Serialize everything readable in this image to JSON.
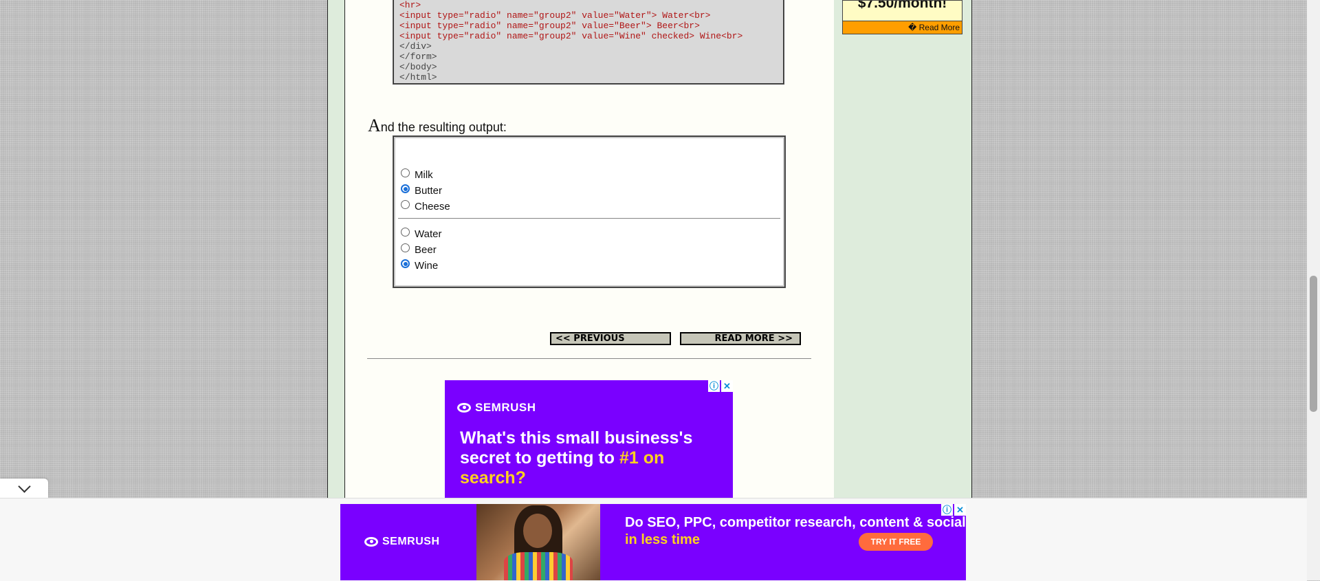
{
  "code_lines": [
    {
      "text": "<hr>",
      "color": "red"
    },
    {
      "text": "<input type=\"radio\" name=\"group2\" value=\"Water\"> Water<br>",
      "color": "red"
    },
    {
      "text": "<input type=\"radio\" name=\"group2\" value=\"Beer\"> Beer<br>",
      "color": "red"
    },
    {
      "text": "<input type=\"radio\" name=\"group2\" value=\"Wine\" checked> Wine<br>",
      "color": "red"
    },
    {
      "text": "</div>",
      "color": "gray"
    },
    {
      "text": "</form>",
      "color": "gray"
    },
    {
      "text": "</body>",
      "color": "gray"
    },
    {
      "text": "</html>",
      "color": "gray"
    }
  ],
  "intro": {
    "dropcap": "A",
    "rest": "nd the resulting output:"
  },
  "output": {
    "group1": [
      {
        "label": "Milk",
        "checked": false
      },
      {
        "label": "Butter",
        "checked": true
      },
      {
        "label": "Cheese",
        "checked": false
      }
    ],
    "group2": [
      {
        "label": "Water",
        "checked": false
      },
      {
        "label": "Beer",
        "checked": false
      },
      {
        "label": "Wine",
        "checked": true
      }
    ]
  },
  "nav": {
    "previous": "<< PREVIOUS",
    "next": "READ MORE >>"
  },
  "sidebar_ad": {
    "price": "$7.50/month!",
    "read_more": "� Read More"
  },
  "ad_content": {
    "brand": "SEMRUSH",
    "headline_part1": "What's this small business's secret to getting to ",
    "headline_highlight": "#1 on search?",
    "info_icon": "ⓘ",
    "close_icon": "✕"
  },
  "ad_bottom": {
    "brand": "SEMRUSH",
    "text_part1": "Do SEO, PPC, competitor research, content & social ",
    "text_highlight": "in less time",
    "cta": "TRY IT FREE",
    "info_icon": "ⓘ",
    "close_icon": "✕"
  },
  "colors": {
    "ad_purple": "#7a00ff",
    "ad_yellow": "#ffd21e",
    "cta_orange": "#ff6b3d",
    "sidebar_orange": "#ff9e00",
    "code_red": "#b01515",
    "radio_blue": "#1a6fd8"
  }
}
